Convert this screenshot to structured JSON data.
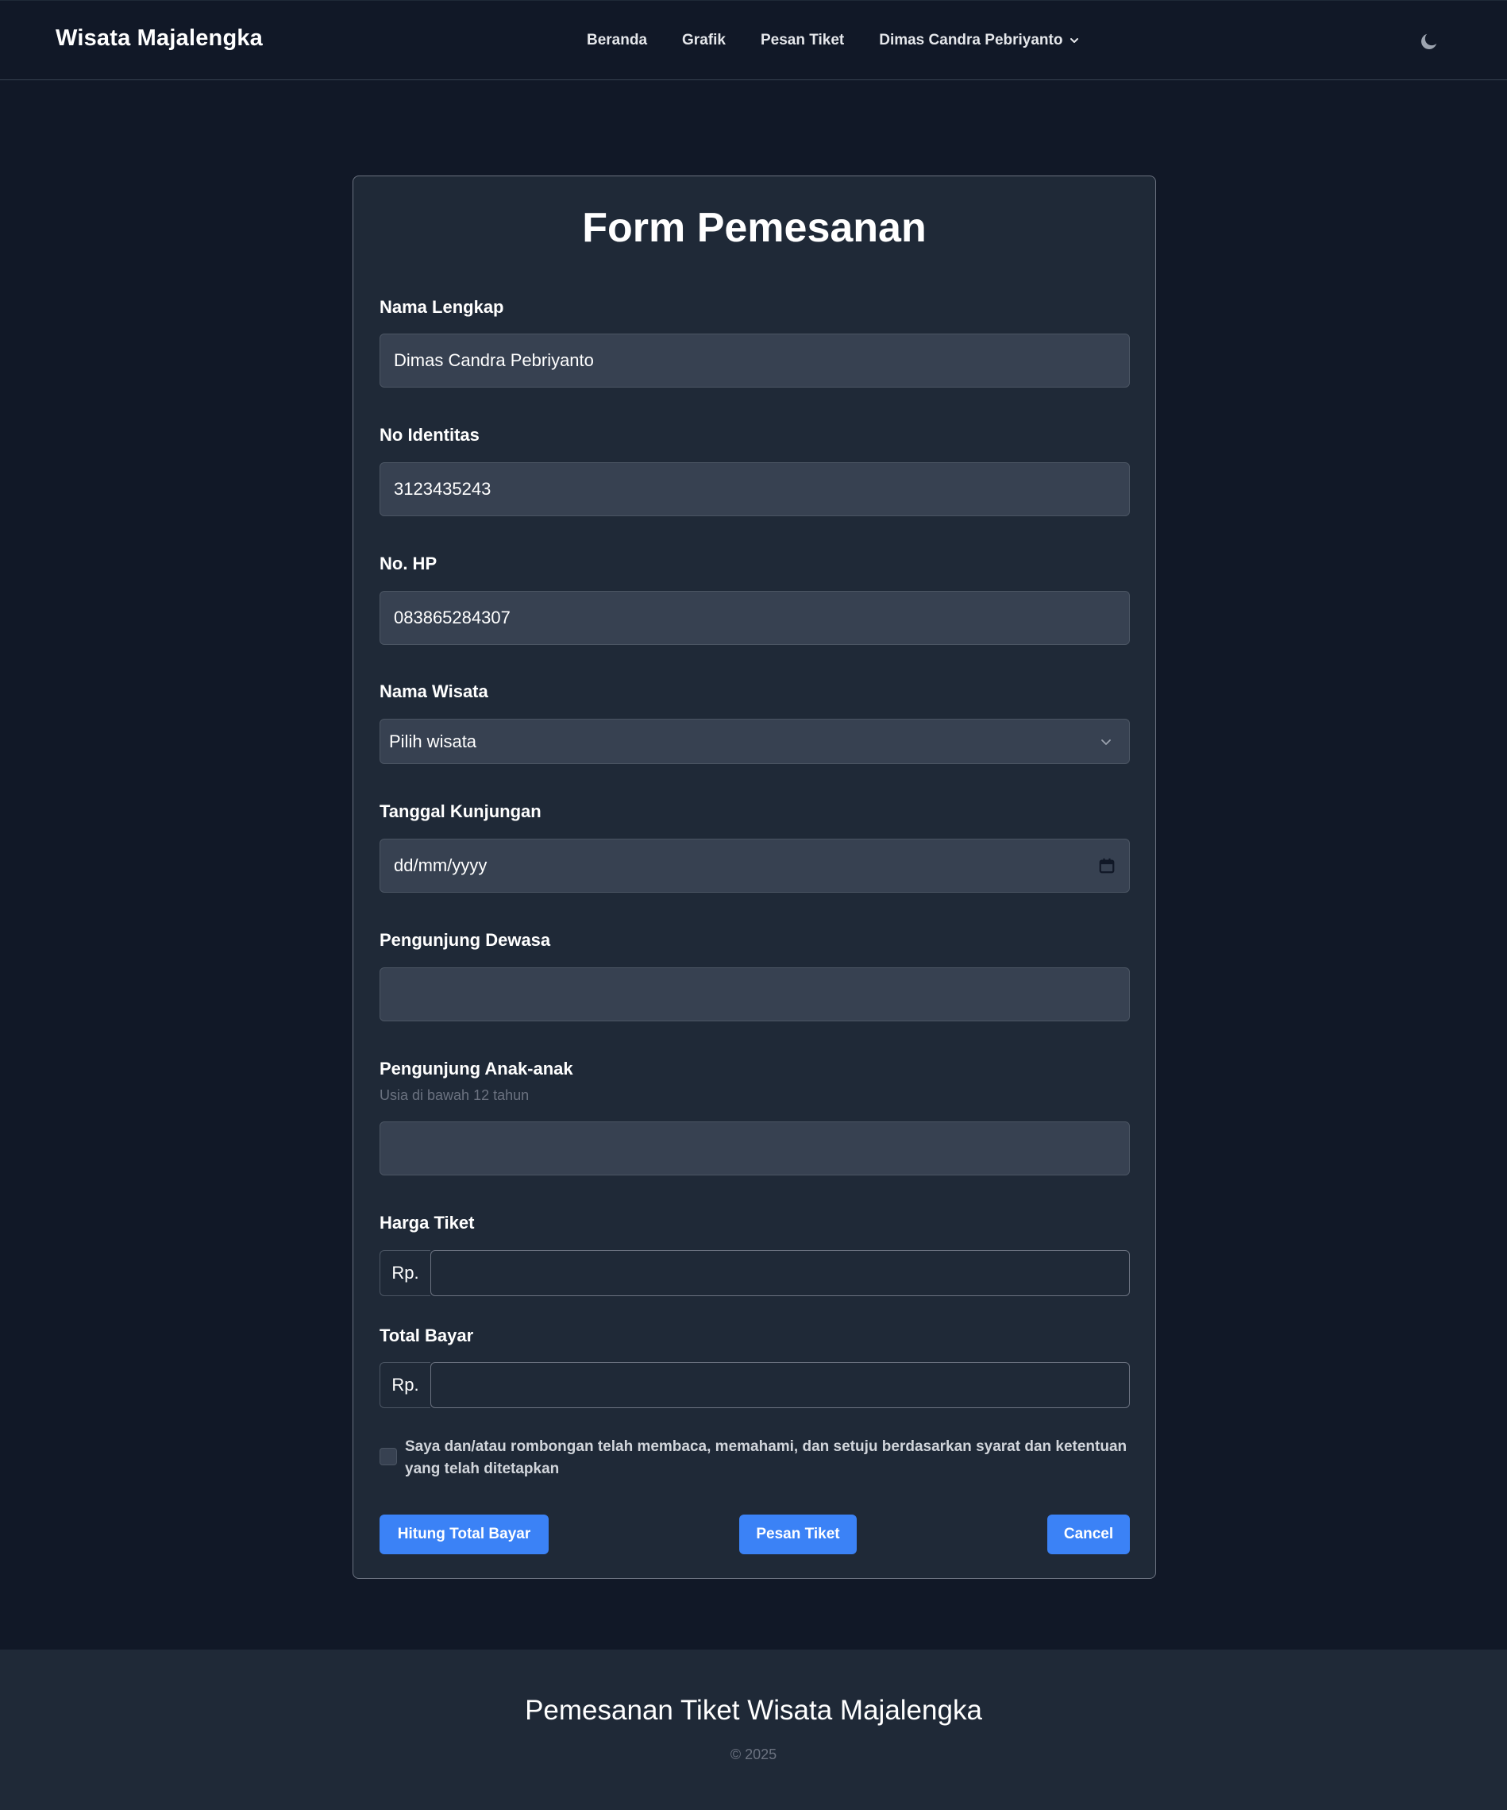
{
  "nav": {
    "brand": "Wisata Majalengka",
    "links": [
      "Beranda",
      "Grafik",
      "Pesan Tiket"
    ],
    "user": "Dimas Candra Pebriyanto"
  },
  "icons": {
    "user_menu": "chevron-down-icon",
    "theme_toggle": "moon-icon",
    "select": "chevron-down-icon",
    "date": "calendar-icon"
  },
  "colors": {
    "background": "#111827",
    "card": "#1f2937",
    "accent": "#3b82f6"
  },
  "form": {
    "title": "Form Pemesanan",
    "nama_lengkap": {
      "label": "Nama Lengkap",
      "value": "Dimas Candra Pebriyanto"
    },
    "no_identitas": {
      "label": "No Identitas",
      "value": "3123435243"
    },
    "no_hp": {
      "label": "No. HP",
      "value": "083865284307"
    },
    "nama_wisata": {
      "label": "Nama Wisata",
      "selected": "Pilih wisata"
    },
    "tanggal": {
      "label": "Tanggal Kunjungan",
      "placeholder": "dd/mm/yyyy"
    },
    "dewasa": {
      "label": "Pengunjung Dewasa",
      "value": ""
    },
    "anak": {
      "label": "Pengunjung Anak-anak",
      "hint": "Usia di bawah 12 tahun",
      "value": ""
    },
    "harga": {
      "label": "Harga Tiket",
      "prefix": "Rp.",
      "value": ""
    },
    "total": {
      "label": "Total Bayar",
      "prefix": "Rp.",
      "value": ""
    },
    "agreement": "Saya dan/atau rombongan telah membaca, memahami, dan setuju berdasarkan syarat dan ketentuan yang telah ditetapkan",
    "buttons": {
      "hitung": "Hitung Total Bayar",
      "pesan": "Pesan Tiket",
      "cancel": "Cancel"
    }
  },
  "footer": {
    "title": "Pemesanan Tiket Wisata Majalengka",
    "copyright": "© 2025"
  }
}
